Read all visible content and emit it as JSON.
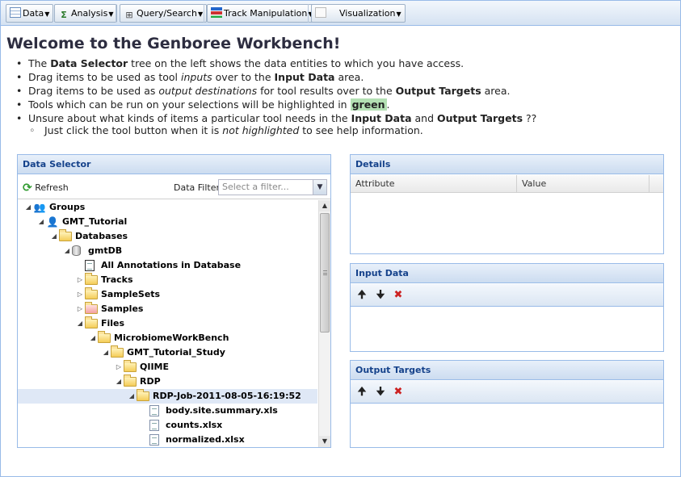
{
  "toolbar": {
    "buttons": [
      {
        "label": "Data",
        "icon": "table-icon"
      },
      {
        "label": "Analysis",
        "icon": "analysis-icon"
      },
      {
        "label": "Query/Search",
        "icon": "binoculars-icon"
      },
      {
        "label": "Track Manipulation",
        "icon": "tracks-icon"
      },
      {
        "label": "Visualization",
        "icon": "visualization-icon"
      }
    ]
  },
  "welcome": {
    "title": "Welcome to the Genboree Workbench!",
    "b1": {
      "p1": "The ",
      "b": "Data Selector",
      "p2": " tree on the left shows the data entities to which you have access."
    },
    "b2": {
      "p1": "Drag items to be used as tool ",
      "i": "inputs",
      "p2": " over to the ",
      "b": "Input Data",
      "p3": " area."
    },
    "b3": {
      "p1": "Drag items to be used as ",
      "i": "output destinations",
      "p2": " for tool results over to the ",
      "b": "Output Targets",
      "p3": " area."
    },
    "b4": {
      "p1": "Tools which can be run on your selections will be highlighted in ",
      "b": "green",
      "p2": "."
    },
    "b5": {
      "p1": "Unsure about what kinds of items a particular tool needs in the ",
      "b1": "Input Data",
      "p2": " and ",
      "b2": "Output Targets",
      "p3": " ??"
    },
    "sub": {
      "p1": "Just click the tool button when it is ",
      "i": "not highlighted",
      "p2": " to see help information."
    }
  },
  "data_selector": {
    "title": "Data Selector",
    "refresh_label": "Refresh",
    "filter_label": "Data Filter:",
    "filter_placeholder": "Select a filter...",
    "tree": [
      {
        "label": "Groups",
        "icon": "groups-icon",
        "expanded": true
      },
      {
        "label": "GMT_Tutorial",
        "icon": "group-icon",
        "expanded": true
      },
      {
        "label": "Databases",
        "icon": "folder-icon",
        "expanded": true
      },
      {
        "label": "gmtDB",
        "icon": "database-icon",
        "expanded": true
      },
      {
        "label": "All Annotations in Database",
        "icon": "annotations-icon",
        "expanded": null
      },
      {
        "label": "Tracks",
        "icon": "folder-icon",
        "expanded": false
      },
      {
        "label": "SampleSets",
        "icon": "folder-icon",
        "expanded": false
      },
      {
        "label": "Samples",
        "icon": "samples-icon",
        "expanded": false
      },
      {
        "label": "Files",
        "icon": "folder-icon",
        "expanded": true
      },
      {
        "label": "MicrobiomeWorkBench",
        "icon": "folder-icon",
        "expanded": true
      },
      {
        "label": "GMT_Tutorial_Study",
        "icon": "folder-icon",
        "expanded": true
      },
      {
        "label": "QIIME",
        "icon": "folder-icon",
        "expanded": false
      },
      {
        "label": "RDP",
        "icon": "folder-icon",
        "expanded": true
      },
      {
        "label": "RDP-Job-2011-08-05-16:19:52",
        "icon": "folder-icon",
        "expanded": true,
        "selected": true
      },
      {
        "label": "body.site.summary.xls",
        "icon": "file-icon",
        "expanded": null
      },
      {
        "label": "counts.xlsx",
        "icon": "file-icon",
        "expanded": null
      },
      {
        "label": "normalized.xlsx",
        "icon": "file-icon",
        "expanded": null
      }
    ]
  },
  "details": {
    "title": "Details",
    "columns": [
      "Attribute",
      "Value"
    ]
  },
  "input_data": {
    "title": "Input Data"
  },
  "output_targets": {
    "title": "Output Targets"
  },
  "colors": {
    "accent": "#15428b",
    "highlight_green": "#b3e0b3",
    "remove_red": "#cc2222"
  }
}
